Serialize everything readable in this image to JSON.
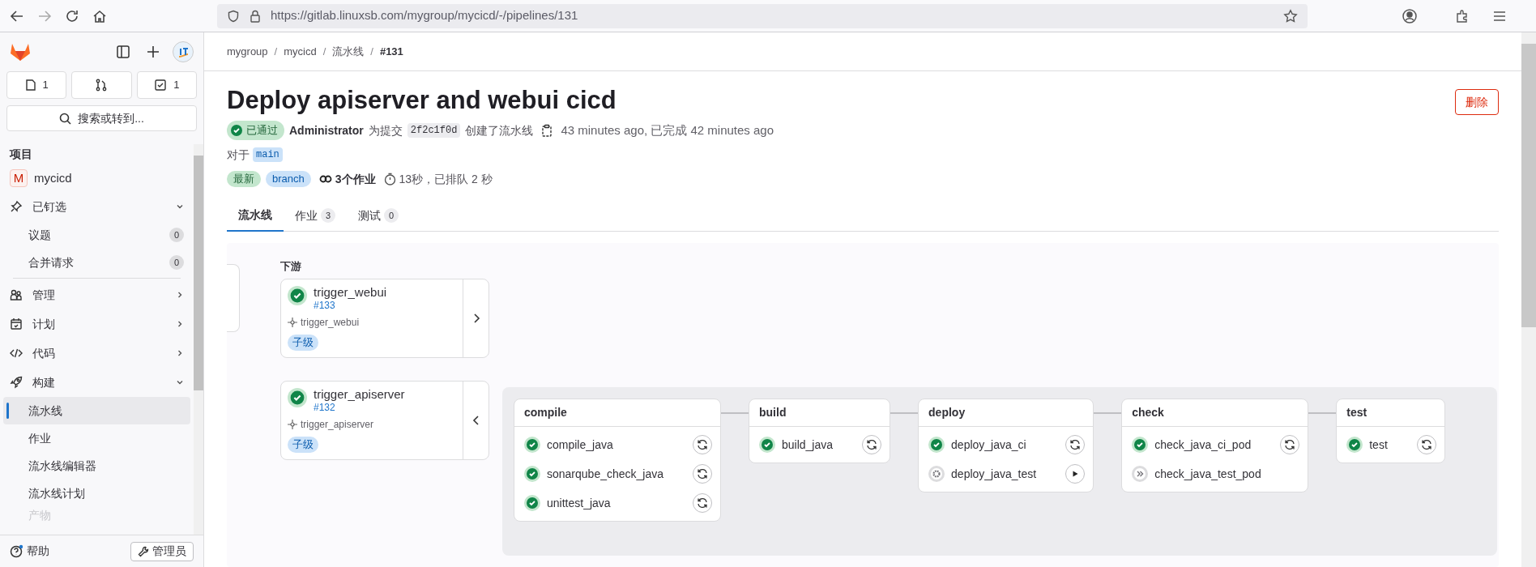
{
  "browser": {
    "url": "https://gitlab.linuxsb.com/mygroup/mycicd/-/pipelines/131"
  },
  "sidebar": {
    "counters": [
      {
        "kind": "issues",
        "count": "1"
      },
      {
        "kind": "merge"
      },
      {
        "kind": "todo",
        "count": "1"
      }
    ],
    "search": {
      "placeholder": "搜索或转到..."
    },
    "section_title": "项目",
    "project": {
      "avatar": "M",
      "name": "mycicd"
    },
    "nav": [
      {
        "label": "已钉选",
        "expanded": true,
        "children": [
          {
            "label": "议题",
            "count": "0",
            "selected": false
          },
          {
            "label": "合并请求",
            "count": "0",
            "selected": false
          }
        ]
      },
      {
        "label": "管理",
        "expanded": false
      },
      {
        "label": "计划",
        "expanded": false
      },
      {
        "label": "代码",
        "expanded": false
      },
      {
        "label": "构建",
        "expanded": true,
        "children": [
          {
            "label": "流水线",
            "selected": true
          },
          {
            "label": "作业",
            "selected": false
          },
          {
            "label": "流水线编辑器",
            "selected": false
          },
          {
            "label": "流水线计划",
            "selected": false
          },
          {
            "label": "产物",
            "selected": false
          }
        ]
      }
    ],
    "help": "帮助",
    "admin": "管理员"
  },
  "breadcrumb_separator": "/",
  "breadcrumb": [
    {
      "label": "mygroup",
      "current": false
    },
    {
      "label": "mycicd",
      "current": false
    },
    {
      "label": "流水线",
      "current": false
    },
    {
      "label": "#131",
      "current": true
    }
  ],
  "title": "Deploy apiserver and webui cicd",
  "delete_button": "删除",
  "meta": {
    "status": "已通过",
    "author": "Administrator",
    "for_commit": "为提交",
    "commit": "2f2c1f0d",
    "created": "创建了流水线",
    "time": "43 minutes ago, 已完成 42 minutes ago"
  },
  "ref": {
    "label": "对于",
    "branch": "main"
  },
  "badges": [
    {
      "label": "最新",
      "color": "#c3e6cd"
    },
    {
      "label": "branch",
      "color": "#cbe2f9"
    }
  ],
  "jobs_count": "3个作业",
  "duration": "13秒，已排队 2 秒",
  "tabs": [
    {
      "label": "流水线",
      "selected": true
    },
    {
      "label": "作业",
      "count": "3",
      "selected": false
    },
    {
      "label": "测试",
      "count": "0",
      "selected": false
    }
  ],
  "downstream": {
    "title": "下游",
    "pipelines": [
      {
        "name": "trigger_webui",
        "id": "#133",
        "job": "trigger_webui",
        "tag": "子级",
        "kind": "success",
        "expanded": false
      },
      {
        "name": "trigger_apiserver",
        "id": "#132",
        "job": "trigger_apiserver",
        "tag": "子级",
        "kind": "success",
        "expanded": true
      }
    ]
  },
  "stages": [
    {
      "name": "compile",
      "jobs": [
        {
          "name": "compile_java",
          "kind": "success"
        },
        {
          "name": "sonarqube_check_java",
          "kind": "success"
        },
        {
          "name": "unittest_java",
          "kind": "success"
        }
      ]
    },
    {
      "name": "build",
      "jobs": [
        {
          "name": "build_java",
          "kind": "success"
        }
      ]
    },
    {
      "name": "deploy",
      "jobs": [
        {
          "name": "deploy_java_ci",
          "kind": "success"
        },
        {
          "name": "deploy_java_test",
          "kind": "manual"
        }
      ]
    },
    {
      "name": "check",
      "jobs": [
        {
          "name": "check_java_ci_pod",
          "kind": "success"
        },
        {
          "name": "check_java_test_pod",
          "kind": "skipped"
        }
      ]
    },
    {
      "name": "test",
      "jobs": [
        {
          "name": "test",
          "kind": "success"
        }
      ]
    }
  ]
}
